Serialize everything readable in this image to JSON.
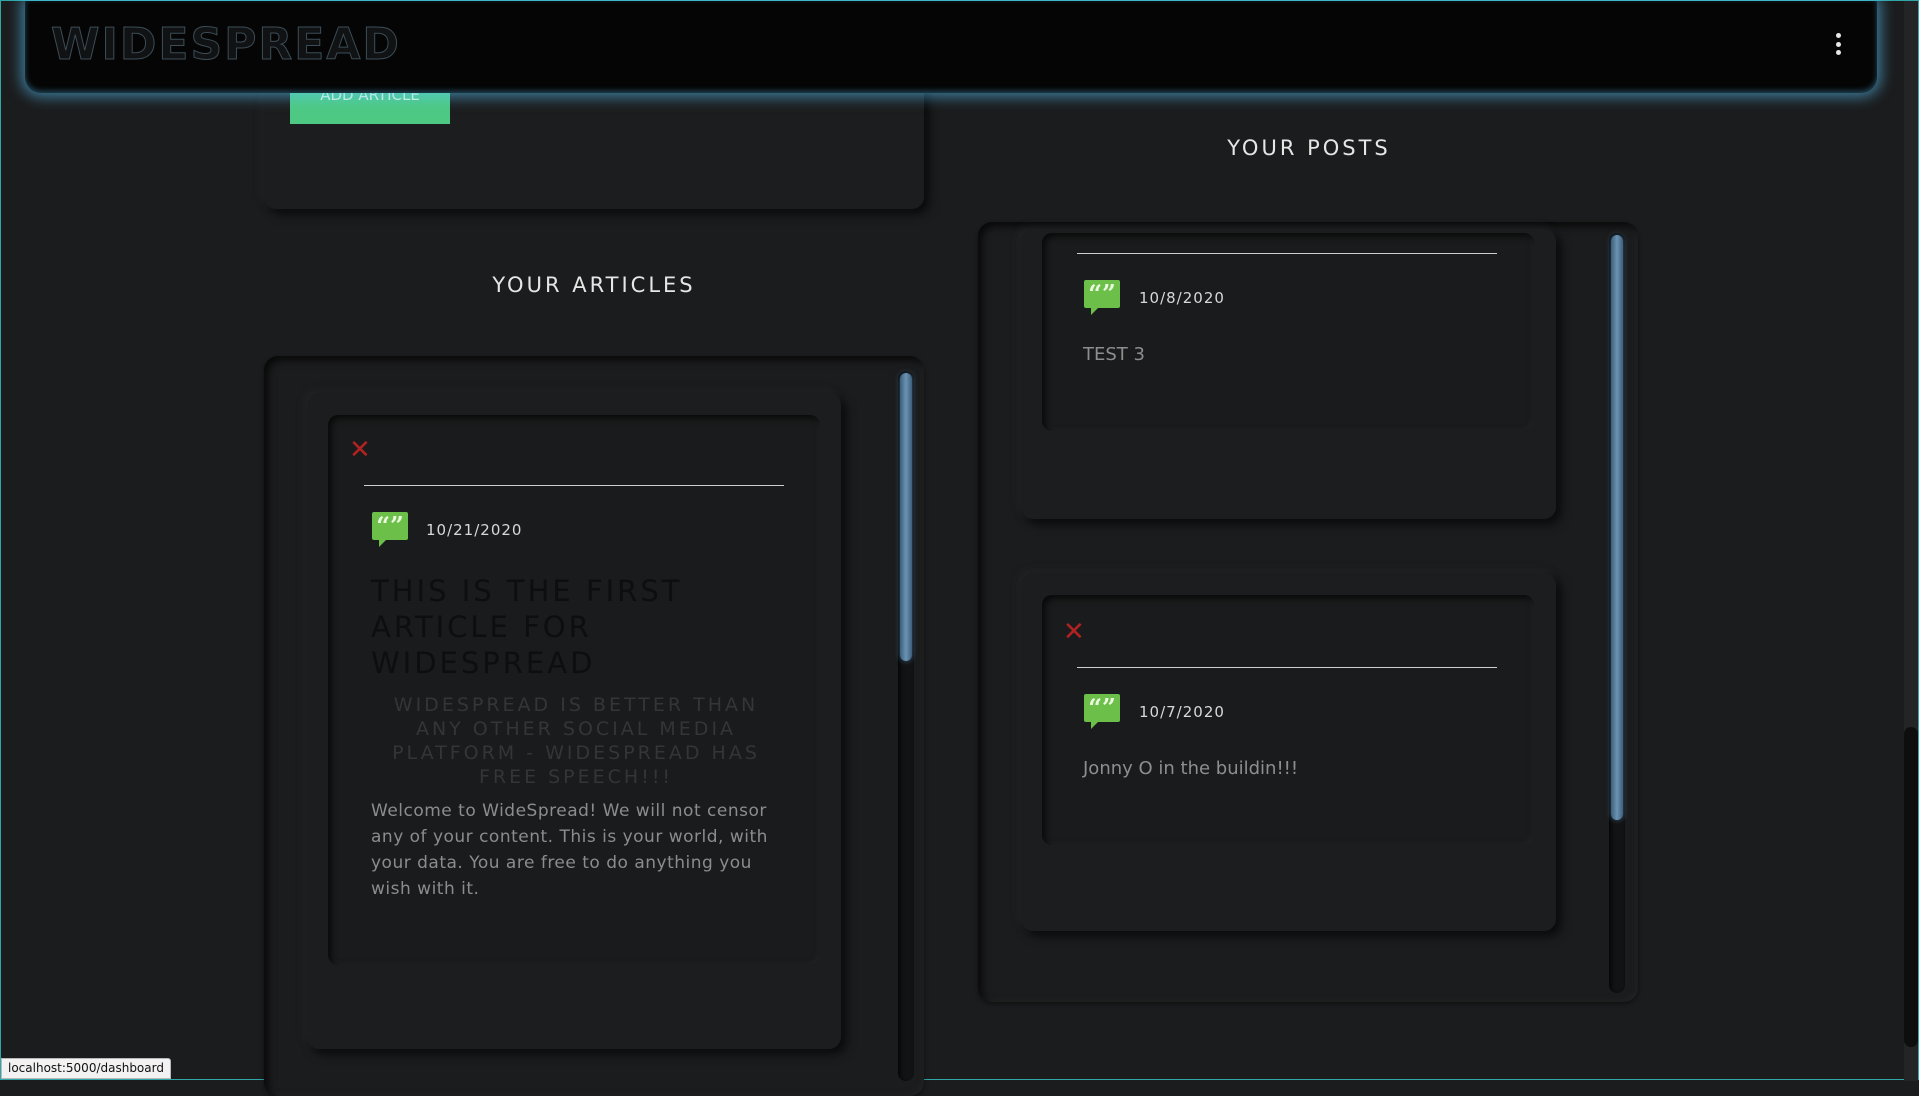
{
  "app": {
    "logo": "WIDESPREAD"
  },
  "toolbar": {
    "add_article_label": "ADD ARTICLE"
  },
  "articles_section": {
    "title": "YOUR ARTICLES",
    "items": [
      {
        "date": "10/21/2020",
        "title": "THIS IS THE FIRST ARTICLE FOR WIDESPREAD",
        "subtitle": "WIDESPREAD IS BETTER THAN ANY OTHER SOCIAL MEDIA PLATFORM - WIDESPREAD HAS FREE SPEECH!!!",
        "body": "Welcome to WideSpread! We will not censor any of your content. This is your world, with your data. You are free to do anything you wish with it."
      }
    ]
  },
  "posts_section": {
    "title": "YOUR POSTS",
    "items": [
      {
        "date": "10/8/2020",
        "text": "TEST 3"
      },
      {
        "date": "10/7/2020",
        "text": "Jonny O in the buildin!!!"
      }
    ]
  },
  "icons": {
    "close": "close-icon",
    "quote": "speech-quote-icon",
    "menu": "kebab-menu-icon"
  },
  "colors": {
    "accent_glow": "#5ac8ff",
    "button_green": "#4ec984",
    "delete_red": "#b22222",
    "quote_green": "#6cc04a"
  },
  "status_bar": {
    "url": "localhost:5000/dashboard"
  }
}
